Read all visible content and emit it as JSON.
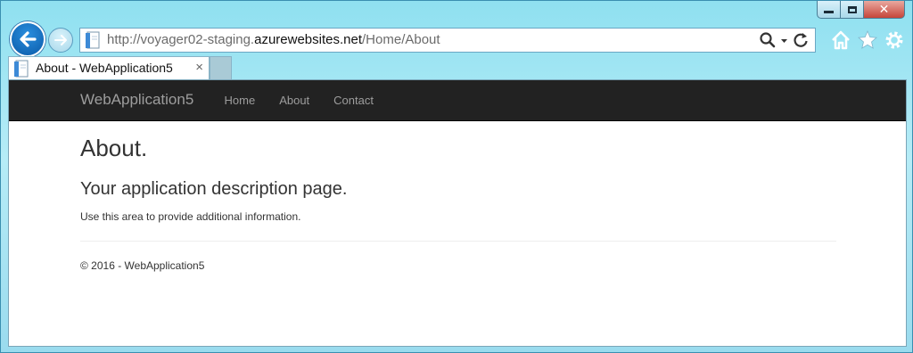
{
  "browser": {
    "url_prefix": "http://voyager02-staging.",
    "url_domain": "azurewebsites.net",
    "url_path": "/Home/About",
    "tab_title": "About - WebApplication5",
    "tab_close": "×",
    "icons": [
      "back-icon",
      "forward-icon",
      "page-icon",
      "search-icon",
      "dropdown-icon",
      "refresh-icon",
      "home-icon",
      "favorites-icon",
      "settings-icon",
      "minimize-icon",
      "maximize-icon",
      "close-icon"
    ]
  },
  "site": {
    "brand": "WebApplication5",
    "nav": [
      "Home",
      "About",
      "Contact"
    ],
    "navbar_color": "#222222"
  },
  "content": {
    "title": "About.",
    "subtitle": "Your application description page.",
    "info": "Use this area to provide additional information.",
    "footer": "© 2016 - WebApplication5"
  }
}
